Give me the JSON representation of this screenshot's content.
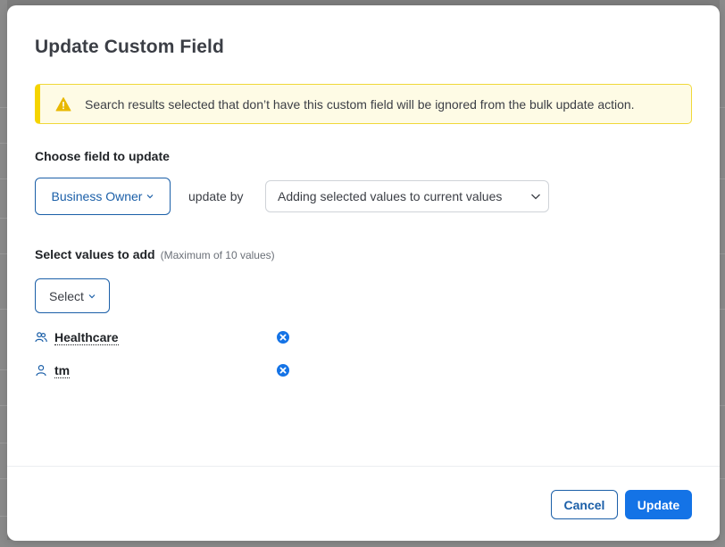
{
  "modal": {
    "title": "Update Custom Field"
  },
  "alert": {
    "icon": "warning-icon",
    "color": "#f5d400",
    "text": "Search results selected that don’t have this custom field will be ignored from the bulk update action."
  },
  "choose_field": {
    "label": "Choose field to update",
    "field_value": "Business Owner",
    "update_by_label": "update by",
    "method_value": "Adding selected values to current values"
  },
  "select_values": {
    "label": "Select values to add",
    "hint": "(Maximum of 10 values)",
    "select_button": "Select",
    "items": [
      {
        "label": "Healthcare",
        "icon": "group-icon"
      },
      {
        "label": "tm",
        "icon": "user-icon"
      }
    ]
  },
  "footer": {
    "cancel_label": "Cancel",
    "update_label": "Update"
  },
  "colors": {
    "accent": "#1b5fa8",
    "primary_button": "#1473e6",
    "remove_icon": "#1473e6"
  }
}
